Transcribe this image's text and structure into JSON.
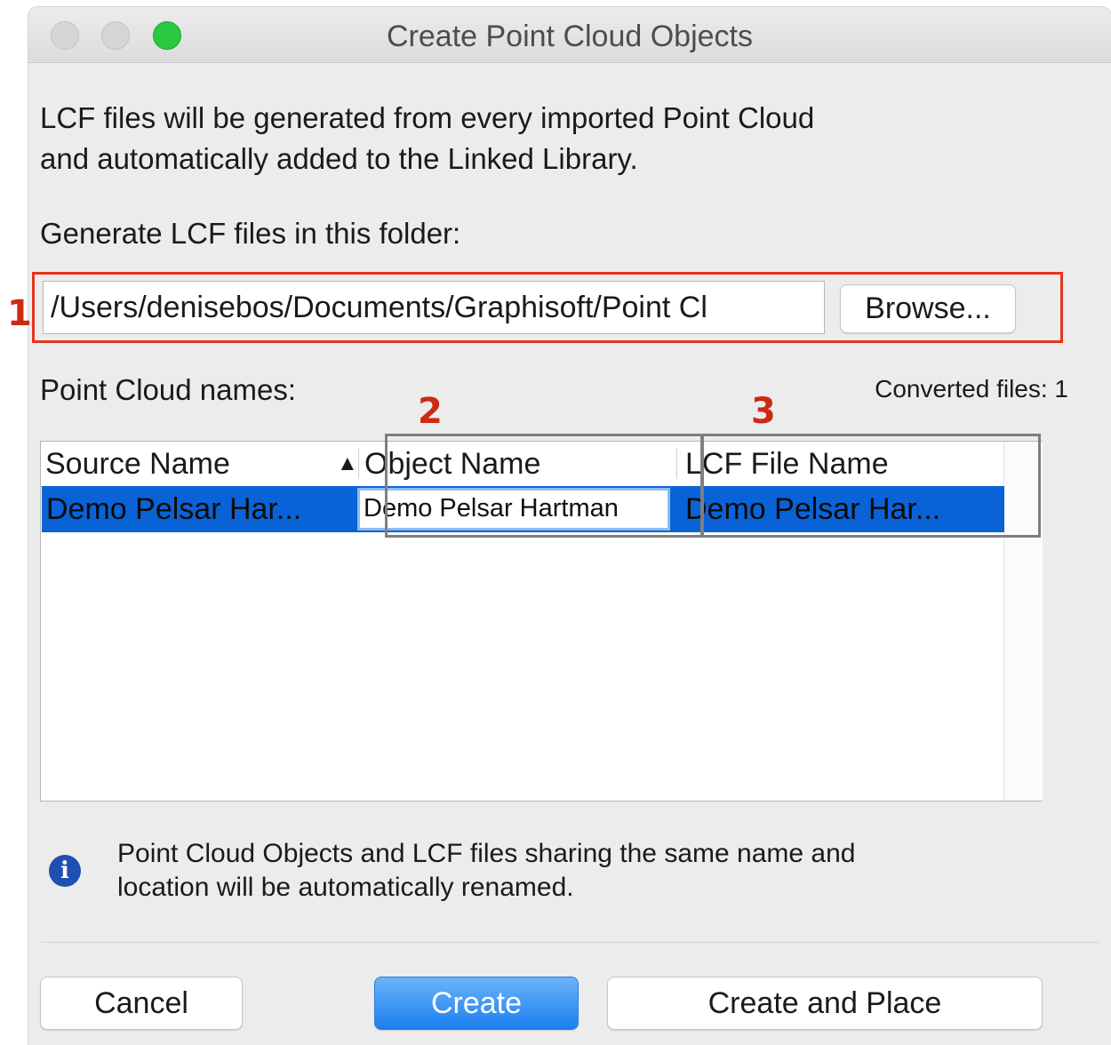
{
  "window": {
    "title": "Create Point Cloud Objects"
  },
  "intro": {
    "line1": "LCF files will be generated from every imported Point Cloud",
    "line2": "and automatically added to the Linked Library."
  },
  "folder": {
    "label": "Generate LCF files in this folder:",
    "path": "/Users/denisebos/Documents/Graphisoft/Point Cl",
    "browse_label": "Browse..."
  },
  "annotations": {
    "m1": "1",
    "m2": "2",
    "m3": "3"
  },
  "names": {
    "label": "Point Cloud names:",
    "converted": "Converted files: 1",
    "columns": [
      "Source Name",
      "Object Name",
      "LCF File Name"
    ],
    "sort_indicator": "▲",
    "rows": [
      {
        "source": "Demo Pelsar Har...",
        "object": "Demo Pelsar Hartman",
        "lcf": "Demo Pelsar Har..."
      }
    ]
  },
  "info": {
    "icon": "info-icon",
    "line1": "Point Cloud Objects and LCF files sharing the same name and",
    "line2": "location will be automatically renamed."
  },
  "buttons": {
    "cancel": "Cancel",
    "create": "Create",
    "create_place": "Create and Place"
  },
  "colors": {
    "selection": "#0a63d6",
    "default_button": "#1b7ff0",
    "annotation_red": "#e8331c",
    "annotation_grey": "#7f7f7f"
  }
}
